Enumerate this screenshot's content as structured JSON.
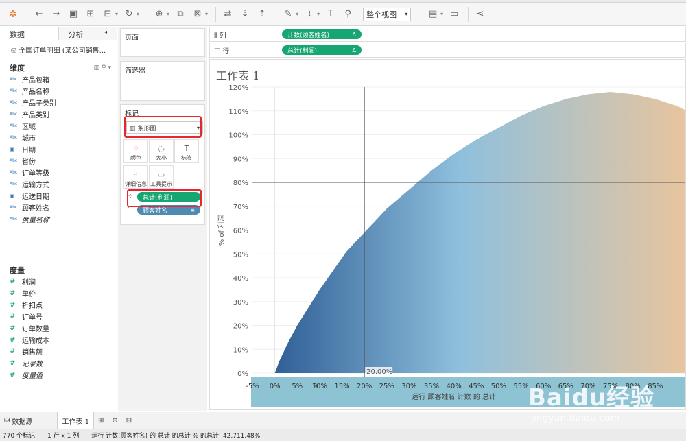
{
  "toolbar": {
    "view_select": "整个视图"
  },
  "data_pane": {
    "tab_data": "数据",
    "tab_analysis": "分析",
    "datasource": "全国订单明细 (某公司销售...",
    "dimensions_header": "维度",
    "dimensions": [
      {
        "type": "Abc",
        "label": "产品包箱"
      },
      {
        "type": "Abc",
        "label": "产品名称"
      },
      {
        "type": "Abc",
        "label": "产品子类别"
      },
      {
        "type": "Abc",
        "label": "产品类别"
      },
      {
        "type": "Abc",
        "label": "区域"
      },
      {
        "type": "Abc",
        "label": "城市"
      },
      {
        "type": "date",
        "label": "日期"
      },
      {
        "type": "Abc",
        "label": "省份"
      },
      {
        "type": "Abc",
        "label": "订单等级"
      },
      {
        "type": "Abc",
        "label": "运输方式"
      },
      {
        "type": "date",
        "label": "运送日期"
      },
      {
        "type": "Abc",
        "label": "顾客姓名"
      },
      {
        "type": "Abc",
        "label": "度量名称"
      }
    ],
    "measures_header": "度量",
    "measures": [
      "利润",
      "单价",
      "折扣点",
      "订单号",
      "订单数量",
      "运输成本",
      "销售额",
      "记录数",
      "度量值"
    ]
  },
  "cards": {
    "pages": "页面",
    "filters": "筛选器",
    "marks": "标记",
    "marks_type": "条形图",
    "mark_buttons": [
      "颜色",
      "大小",
      "标签",
      "详细信息",
      "工具提示"
    ],
    "pill_profit": "总计(利润)",
    "pill_customer": "顾客姓名"
  },
  "shelves": {
    "columns_label": "列",
    "columns_pill": "计数(顾客姓名)",
    "rows_label": "行",
    "rows_pill": "总计(利润)"
  },
  "view": {
    "title": "工作表 1"
  },
  "chart_data": {
    "type": "bar",
    "ylabel": "% of 利润",
    "xlabel": "运行 顾客姓名 计数 的 总计",
    "x_ticks": [
      "-5%",
      "0%",
      "5%",
      "10%",
      "15%",
      "20%",
      "25%",
      "30%",
      "35%",
      "40%",
      "45%",
      "50%",
      "55%",
      "60%",
      "65%",
      "70%",
      "75%",
      "80%",
      "85%",
      "9"
    ],
    "y_ticks": [
      "0%",
      "10%",
      "20%",
      "30%",
      "40%",
      "50%",
      "60%",
      "70%",
      "80%",
      "90%",
      "100%",
      "110%",
      "120%"
    ],
    "xlim": [
      -5,
      92
    ],
    "ylim": [
      0,
      120
    ],
    "reference_x": 20,
    "reference_x_label": "20.00%",
    "reference_y": 80,
    "curve": {
      "x": [
        0,
        1,
        2,
        3,
        5,
        7,
        10,
        13,
        16,
        20,
        25,
        30,
        35,
        40,
        45,
        50,
        55,
        60,
        65,
        70,
        75,
        80,
        85,
        90,
        92
      ],
      "y": [
        0,
        5,
        9,
        13,
        20,
        26,
        35,
        43,
        51,
        59,
        69,
        77,
        85,
        92,
        98,
        103,
        108,
        112,
        115,
        117,
        118,
        117,
        115,
        112,
        110
      ]
    },
    "colors": {
      "start": "#2f5f96",
      "mid": "#8fc0dd",
      "end": "#e8c59e"
    }
  },
  "sheet_tabs": {
    "datasource": "数据源",
    "sheet1": "工作表 1"
  },
  "status": {
    "marks": "770 个标记",
    "rows_cols": "1 行 x 1 列",
    "sum": "运行 计数(顾客姓名) 的 总计 的总计 % 的总计: 42,711.48%"
  },
  "watermark": {
    "brand": "Baidu经验",
    "url": "jingyan.baidu.com"
  }
}
